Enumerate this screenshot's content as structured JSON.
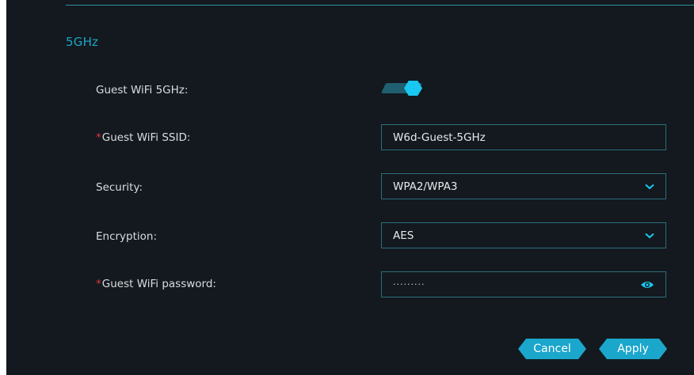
{
  "section": {
    "title": "5GHz"
  },
  "rows": {
    "guest_wifi": {
      "label": "Guest WiFi 5GHz:",
      "enabled": true
    },
    "ssid": {
      "required_mark": "*",
      "label": "Guest WiFi SSID:",
      "value": "W6d-Guest-5GHz"
    },
    "security": {
      "label": "Security:",
      "value": "WPA2/WPA3"
    },
    "encryption": {
      "label": "Encryption:",
      "value": "AES"
    },
    "password": {
      "required_mark": "*",
      "label": "Guest WiFi password:",
      "masked_value": "·········"
    }
  },
  "buttons": {
    "cancel": "Cancel",
    "apply": "Apply"
  },
  "icons": {
    "dropdown": "chevron-down-icon",
    "show_password": "eye-icon"
  },
  "colors": {
    "accent": "#18c8f0",
    "background": "#13191e",
    "border": "#2c6e7d",
    "required": "#e0343c"
  }
}
